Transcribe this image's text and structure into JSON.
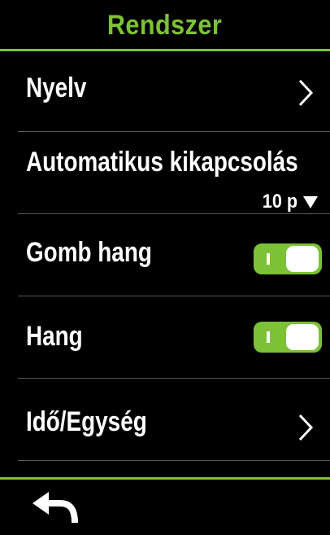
{
  "header": {
    "title": "Rendszer"
  },
  "items": [
    {
      "label": "Nyelv"
    },
    {
      "label": "Automatikus kikapcsolás",
      "value": "10 p"
    },
    {
      "label": "Gomb hang",
      "toggle_on": true
    },
    {
      "label": "Hang",
      "toggle_on": true
    },
    {
      "label": "Idő/Egység"
    }
  ],
  "icons": {
    "chevron": "chevron-right-icon",
    "dropdown": "triangle-down-icon",
    "back": "back-arrow-icon"
  },
  "colors": {
    "accent": "#7cc136",
    "background": "#000000",
    "text": "#ffffff",
    "divider": "#5a5a5a"
  }
}
